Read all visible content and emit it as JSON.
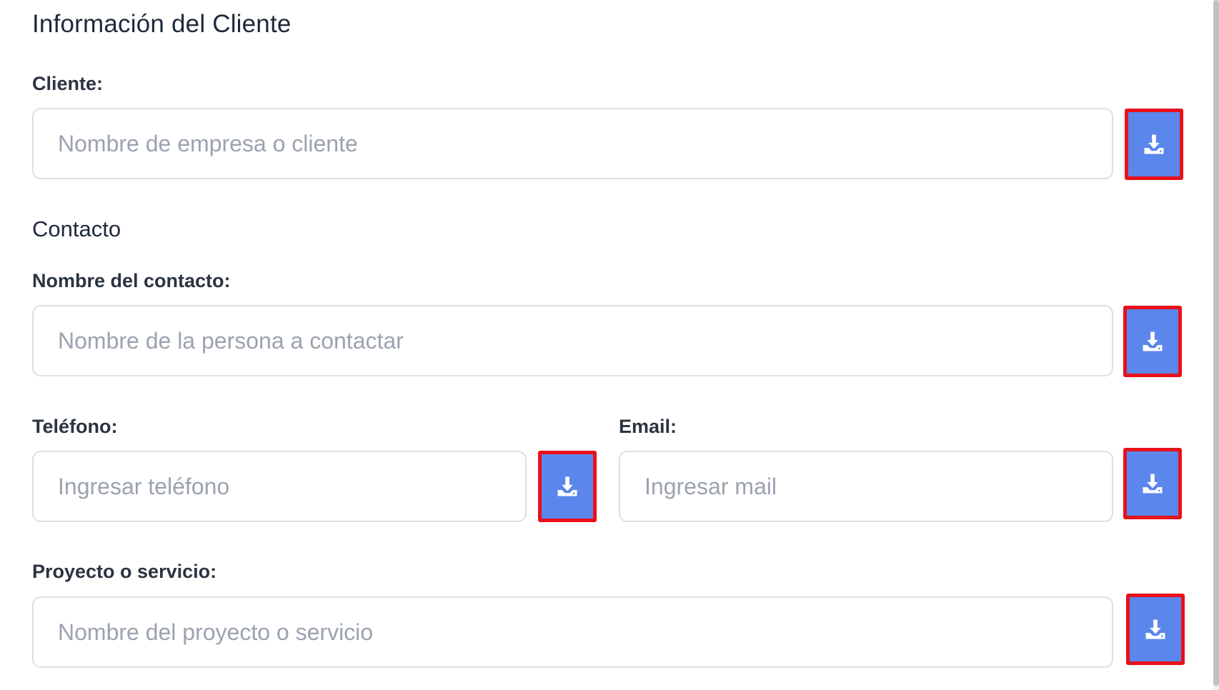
{
  "form": {
    "title": "Información del Cliente",
    "cliente": {
      "label": "Cliente:",
      "placeholder": "Nombre de empresa o cliente",
      "value": ""
    },
    "contacto_section": "Contacto",
    "nombre_contacto": {
      "label": "Nombre del contacto:",
      "placeholder": "Nombre de la persona a contactar",
      "value": ""
    },
    "telefono": {
      "label": "Teléfono:",
      "placeholder": "Ingresar teléfono",
      "value": ""
    },
    "email": {
      "label": "Email:",
      "placeholder": "Ingresar mail",
      "value": ""
    },
    "proyecto": {
      "label": "Proyecto o servicio:",
      "placeholder": "Nombre del proyecto o servicio",
      "value": ""
    }
  },
  "icons": {
    "field_button": "download-icon"
  },
  "colors": {
    "button_bg": "#5b86ec",
    "highlight_border": "#e8101a",
    "input_border": "#dcdfe4",
    "placeholder": "#9ca3af",
    "heading": "#1e293b"
  }
}
